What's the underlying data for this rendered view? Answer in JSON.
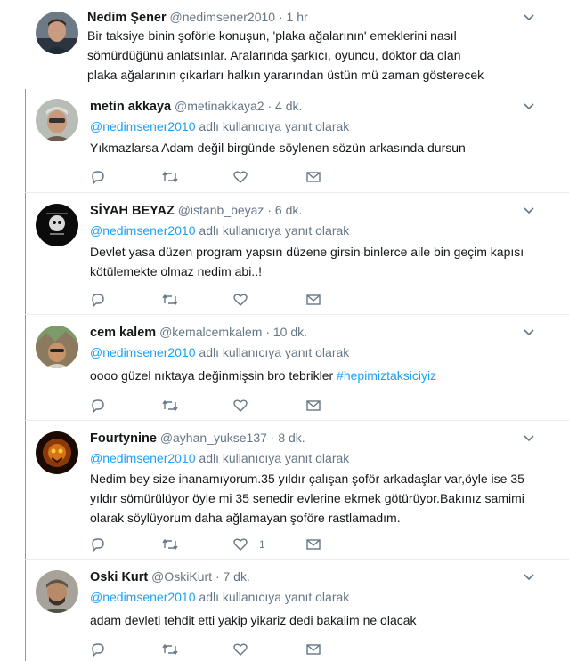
{
  "main_tweet": {
    "name": "Nedim Şener",
    "handle": "@nedimsener2010",
    "dot": "·",
    "time": "1 hr",
    "text": "Bir taksiye binin şoförle konuşun, 'plaka ağalarının' emeklerini nasıl sömürdüğünü anlatsınlar. Aralarında şarkıcı, oyuncu, doktor da olan plaka ağalarının çıkarları halkın yararından üstün mü zaman gösterecek"
  },
  "replies": [
    {
      "name": "metin akkaya",
      "handle": "@metinakkaya2",
      "time": "4 dk.",
      "reply_mention": "@nedimsener2010",
      "reply_suffix": "adlı kullanıcıya yanıt olarak",
      "text": "Yıkmazlarsa Adam değil birgünde söylenen sözün arkasında dursun",
      "like_count": ""
    },
    {
      "name": "SİYAH BEYAZ",
      "handle": "@istanb_beyaz",
      "time": "6 dk.",
      "reply_mention": "@nedimsener2010",
      "reply_suffix": "adlı kullanıcıya yanıt olarak",
      "text": "Devlet yasa düzen program yapsın düzene girsin binlerce aile bin geçim kapısı kötülemekte olmaz nedim abi..!",
      "like_count": ""
    },
    {
      "name": "cem kalem",
      "handle": "@kemalcemkalem",
      "time": "10 dk.",
      "reply_mention": "@nedimsener2010",
      "reply_suffix": "adlı kullanıcıya yanıt olarak",
      "text": "oooo güzel nıktaya değinmişsin bro tebrikler",
      "hashtag": "#hepimiztaksiciyiz",
      "like_count": ""
    },
    {
      "name": "Fourtynine",
      "handle": "@ayhan_yukse137",
      "time": "8 dk.",
      "reply_mention": "@nedimsener2010",
      "reply_suffix": "adlı kullanıcıya yanıt olarak",
      "text": "Nedim bey size inanamıyorum.35 yıldır çalışan şoför arkadaşlar var,öyle ise 35 yıldır sömürülüyor öyle mi 35 senedir evlerine ekmek götürüyor.Bakınız samimi olarak söylüyorum daha ağlamayan şoföre rastlamadım.",
      "like_count": "1"
    },
    {
      "name": "Oski Kurt",
      "handle": "@OskiKurt",
      "time": "7 dk.",
      "reply_mention": "@nedimsener2010",
      "reply_suffix": "adlı kullanıcıya yanıt olarak",
      "text": "adam devleti tehdit etti yakip yikariz dedi bakalim ne olacak",
      "like_count": ""
    }
  ],
  "icons": {
    "reply": "reply-icon",
    "retweet": "retweet-icon",
    "like": "heart-icon",
    "dm": "envelope-icon",
    "more": "chevron-down-icon"
  },
  "colors": {
    "link": "#1da1f2",
    "muted": "#657786",
    "text": "#14171a",
    "divider": "#e6ecf0"
  }
}
